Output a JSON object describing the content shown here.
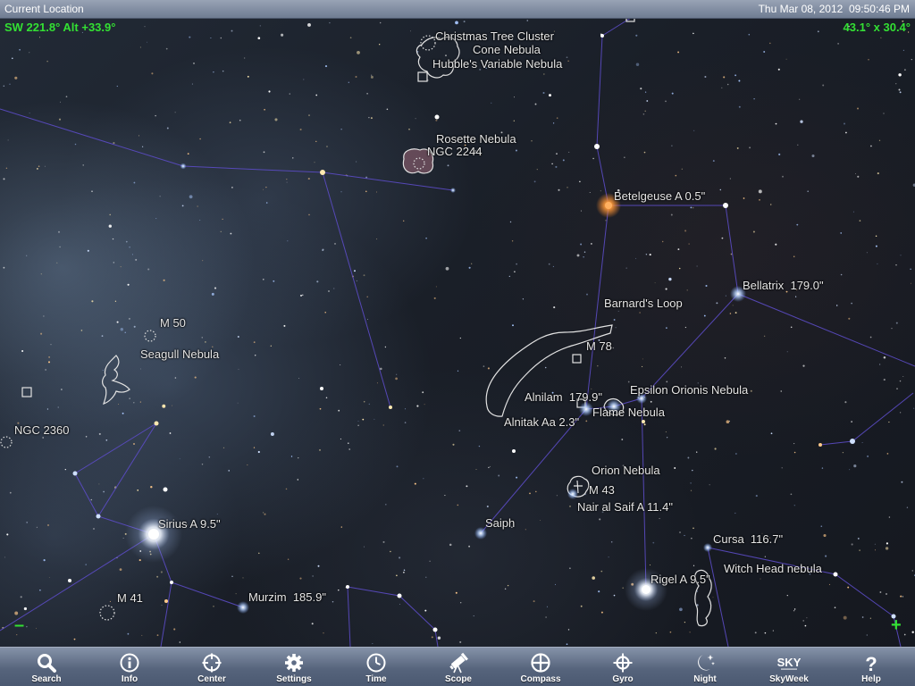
{
  "status_bar": {
    "location": "Current Location",
    "datetime": "Thu Mar 08, 2012  09:50:46 PM"
  },
  "hud": {
    "pointing": "SW 221.8° Alt +33.9°",
    "field_of_view": "43.1° x 30.4°",
    "zoom_out": "–",
    "zoom_in": "+"
  },
  "sky_objects": [
    {
      "label": "Christmas Tree Cluster"
    },
    {
      "label": "Cone Nebula"
    },
    {
      "label": "Hubble's Variable Nebula"
    },
    {
      "label": "Rosette Nebula"
    },
    {
      "label": "NGC 2244"
    },
    {
      "label": "Betelgeuse A 0.5\""
    },
    {
      "label": "Bellatrix  179.0\""
    },
    {
      "label": "Barnard's Loop"
    },
    {
      "label": "M 78"
    },
    {
      "label": "M 50"
    },
    {
      "label": "Seagull Nebula"
    },
    {
      "label": "Alnilam  179.9\""
    },
    {
      "label": "Epsilon Orionis Nebula"
    },
    {
      "label": "Flame Nebula"
    },
    {
      "label": "Alnitak Aa 2.3\""
    },
    {
      "label": "NGC 2360"
    },
    {
      "label": "Orion Nebula"
    },
    {
      "label": "M 43"
    },
    {
      "label": "Nair al Saif A 11.4\""
    },
    {
      "label": "Sirius A 9.5\""
    },
    {
      "label": "Saiph"
    },
    {
      "label": "Cursa  116.7\""
    },
    {
      "label": "Witch Head nebula"
    },
    {
      "label": "Rigel A 9.5\""
    },
    {
      "label": "Murzim  185.9\""
    },
    {
      "label": "M 41"
    }
  ],
  "toolbar": {
    "buttons": [
      {
        "label": "Search",
        "icon": "search-icon"
      },
      {
        "label": "Info",
        "icon": "info-icon"
      },
      {
        "label": "Center",
        "icon": "crosshair-icon"
      },
      {
        "label": "Settings",
        "icon": "gear-icon"
      },
      {
        "label": "Time",
        "icon": "clock-icon"
      },
      {
        "label": "Scope",
        "icon": "telescope-icon"
      },
      {
        "label": "Compass",
        "icon": "compass-icon"
      },
      {
        "label": "Gyro",
        "icon": "gyro-icon"
      },
      {
        "label": "Night",
        "icon": "moon-icon"
      },
      {
        "label": "SkyWeek",
        "icon": "skyweek-logo-icon",
        "logo_text": "SKY"
      },
      {
        "label": "Help",
        "icon": "help-icon",
        "glyph": "?"
      }
    ]
  },
  "colors": {
    "hud_text": "#33e033",
    "label_text": "#e6e6e6",
    "constellation_line": "#5b4bc4",
    "betelgeuse": "#ffb060",
    "toolbar_text": "#ffffff"
  }
}
